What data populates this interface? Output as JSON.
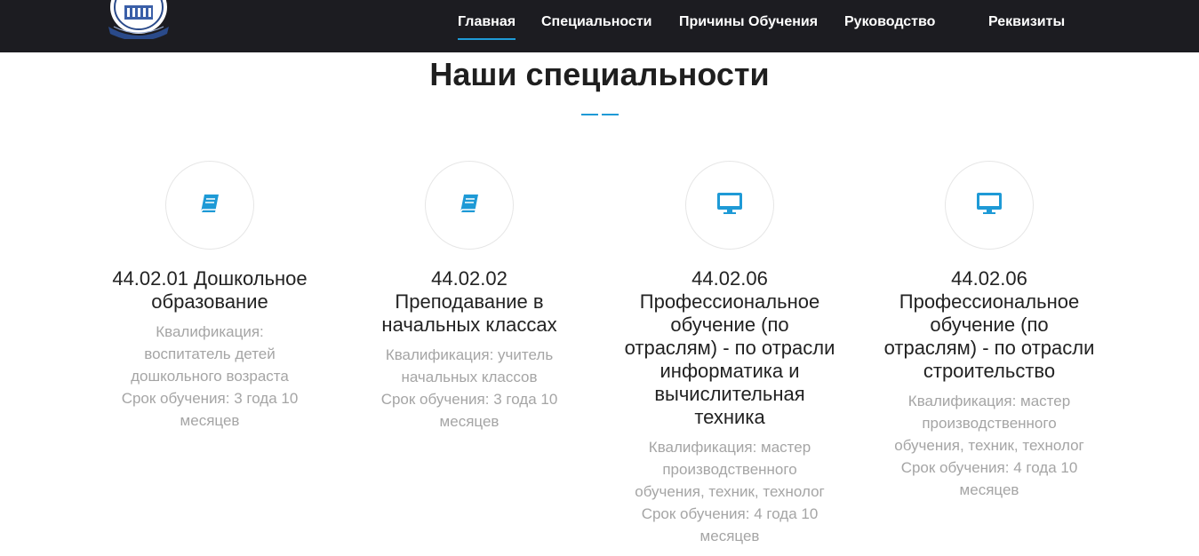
{
  "nav": {
    "items": [
      {
        "label": "Главная",
        "active": true
      },
      {
        "label": "Специальности",
        "active": false
      },
      {
        "label": "Причины Обучения",
        "active": false
      },
      {
        "label": "Руководство",
        "active": false
      },
      {
        "label": "Реквизиты",
        "active": false
      }
    ]
  },
  "section": {
    "title": "Наши специальности"
  },
  "colors": {
    "accent": "#1e9ad6",
    "topbar": "#1c1c21"
  },
  "cards": [
    {
      "icon": "book-icon",
      "title": "44.02.01 Дошкольное образование",
      "qualification": "Квалификация: воспитатель детей дошкольного возраста",
      "duration": "Срок обучения: 3 года 10 месяцев"
    },
    {
      "icon": "book-icon",
      "title": "44.02.02 Преподавание в начальных классах",
      "qualification": "Квалификация: учитель начальных классов",
      "duration": "Срок обучения: 3 года 10 месяцев"
    },
    {
      "icon": "monitor-icon",
      "title": "44.02.06 Профессиональное обучение (по отраслям) - по отрасли информатика и вычислительная техника",
      "qualification": "Квалификация: мастер производственного обучения, техник, технолог",
      "duration": "Срок обучения: 4 года 10 месяцев"
    },
    {
      "icon": "monitor-icon",
      "title": "44.02.06 Профессиональное обучение (по отраслям) - по отрасли строительство",
      "qualification": "Квалификация: мастер производственного обучения, техник, технолог",
      "duration": "Срок обучения: 4 года 10 месяцев"
    }
  ]
}
